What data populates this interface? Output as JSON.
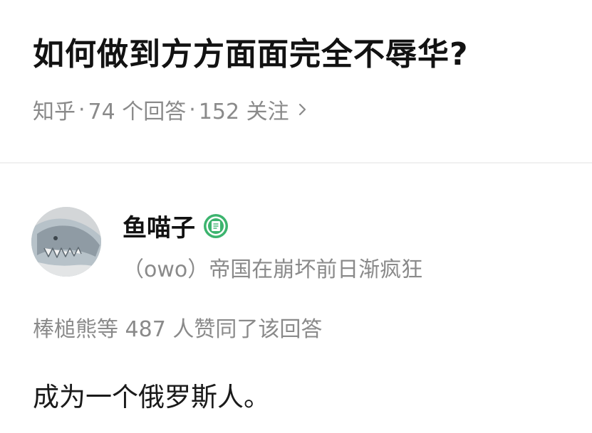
{
  "question": {
    "title": "如何做到方方面面完全不辱华?",
    "meta": {
      "source": "知乎",
      "answers": "74 个回答",
      "followers": "152 关注"
    }
  },
  "answer": {
    "author": {
      "name": "鱼喵子",
      "bio": "（owo）帝国在崩坏前日渐疯狂",
      "badge_icon": "badge-icon"
    },
    "vote_summary": "棒槌熊等 487 人赞同了该回答",
    "content": "成为一个俄罗斯人。"
  },
  "colors": {
    "title": "#121212",
    "meta": "#8a8a8a",
    "badge_green": "#3cb46e",
    "divider": "#f0f0f0"
  }
}
